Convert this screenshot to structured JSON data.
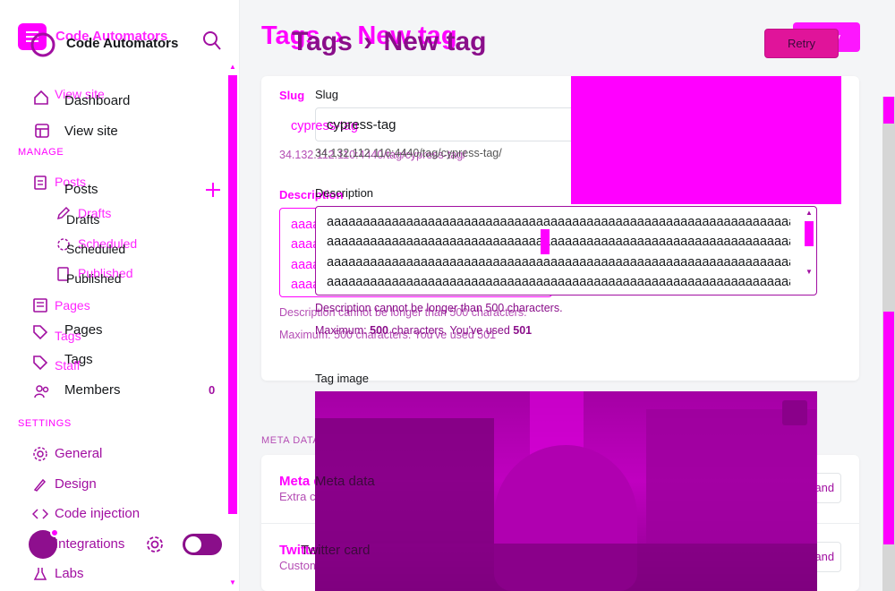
{
  "sidebar": {
    "site_title": "Code Automators",
    "site_title_ghost": "Code Automators",
    "view_site_ghost": "View site",
    "items_top": [
      {
        "label": "Dashboard",
        "icon": "home-icon"
      },
      {
        "label": "View site",
        "icon": "layout-icon"
      }
    ],
    "manage_heading": "MANAGE",
    "posts_label": "Posts",
    "posts_ghost": "Posts",
    "posts_sub": [
      {
        "label": "Drafts",
        "ghost": "Drafts"
      },
      {
        "label": "Scheduled",
        "ghost": "Scheduled"
      },
      {
        "label": "Published",
        "ghost": "Published"
      }
    ],
    "pages_label": "Pages",
    "pages_ghost": "Pages",
    "tags_label": "Tags",
    "tags_ghost": "Tags",
    "staff_ghost": "Staff",
    "members_label": "Members",
    "members_count": "0",
    "settings_heading": "SETTINGS",
    "settings_items": [
      {
        "label": "General",
        "icon": "gear-icon"
      },
      {
        "label": "Design",
        "icon": "brush-icon"
      },
      {
        "label": "Code injection",
        "icon": "code-icon"
      },
      {
        "label": "Integrations",
        "icon": "plug-icon"
      },
      {
        "label": "Labs",
        "icon": "flask-icon"
      }
    ]
  },
  "header": {
    "breadcrumb_parent": "Tags",
    "breadcrumb_separator": "›",
    "breadcrumb_current": "New tag",
    "save_label": "Retry",
    "save_label_ghost": "Retry"
  },
  "form": {
    "slug_label": "Slug",
    "slug_value": "cypress-tag",
    "slug_url": "34.132.112.110:4440/tag/cypress-tag/",
    "description_label": "Description",
    "description_lines": [
      "aaaaaaaaaaaaaaaaaaaaaaaaaaaaaaaaaaaaaaaaaaaaaaaaaaaaaaaaaaaaaaaaaaaaaa",
      "aaaaaaaaaaaaaaaaaaaaaaaaaaaaaaaaaaaaaaaaaaaaaaaaaaaaaaaaaaaaaaaaaaaaaa",
      "aaaaaaaaaaaaaaaaaaaaaaaaaaaaaaaaaaaaaaaaaaaaaaaaaaaaaaaaaaaaaaaaaaaaaa",
      "aaaaaaaaaaaaaaaaaaaaaaaaaaaaaaaaaaaaaaaaaaaaaaaaaaaaaaaaaaaaaaaaaaaaaa"
    ],
    "description_error": "Description cannot be longer than 500 characters.",
    "max_prefix": "Maximum: ",
    "max_value": "500",
    "max_middle": " characters. You've used ",
    "used_value": "501",
    "tag_image_label": "Tag image"
  },
  "meta_section": {
    "heading": "META DATA",
    "meta_title": "Meta data",
    "meta_desc": "Extra content for search engines",
    "twitter_title": "Twitter card",
    "twitter_desc": "Customized structured data for Twitter",
    "expand_label": "Expand"
  },
  "colors": {
    "accent": "#ff00ff",
    "accent_dark": "#a10fa1",
    "primary_button": "#e0149a"
  }
}
